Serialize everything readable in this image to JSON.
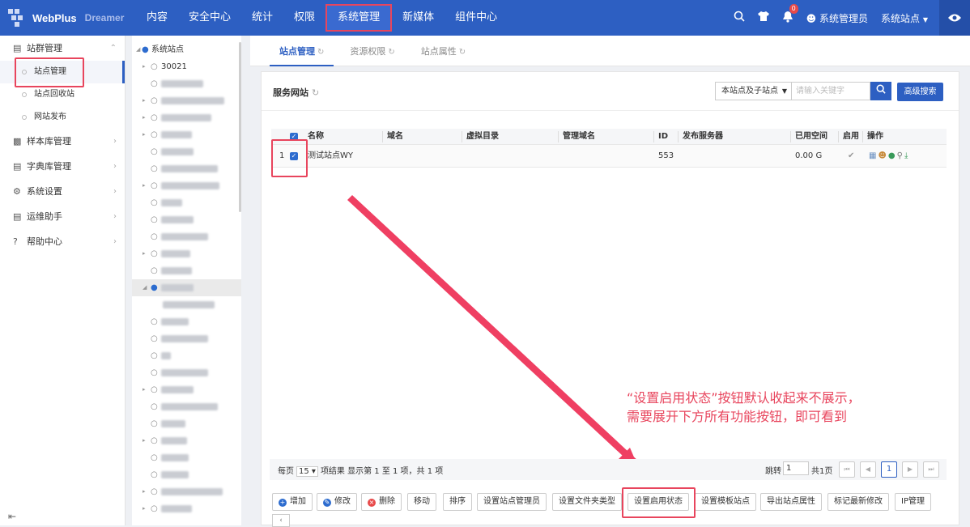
{
  "app": {
    "brand": "WebPlus",
    "brand_sub": "Dreamer"
  },
  "nav": {
    "items": [
      "内容",
      "安全中心",
      "统计",
      "权限",
      "系统管理",
      "新媒体",
      "组件中心"
    ],
    "active_index": 4
  },
  "topbar": {
    "search_icon": "search-icon",
    "shirt_icon": "shirt-icon",
    "bell_icon": "bell-icon",
    "notification_count": "0",
    "user": "系统管理员",
    "site": "系统站点",
    "eye_icon": "eye-icon"
  },
  "sidebar": {
    "groups": [
      {
        "label": "站群管理",
        "subs": [
          "站点管理",
          "站点回收站",
          "网站发布"
        ]
      },
      {
        "label": "样本库管理"
      },
      {
        "label": "字典库管理"
      },
      {
        "label": "系统设置"
      },
      {
        "label": "运维助手"
      },
      {
        "label": "帮助中心"
      }
    ],
    "active_sub": "站点管理"
  },
  "tree": {
    "root": "系统站点",
    "first_child": "30021"
  },
  "tabs": [
    "站点管理",
    "资源权限",
    "站点属性"
  ],
  "panel": {
    "title": "服务网站",
    "scope": "本站点及子站点",
    "keyword_placeholder": "请输入关键字",
    "advanced_search": "高级搜索"
  },
  "grid": {
    "columns": [
      "名称",
      "域名",
      "虚拟目录",
      "管理域名",
      "ID",
      "发布服务器",
      "已用空间",
      "启用",
      "操作"
    ],
    "rows": [
      {
        "index": "1",
        "name": "测试站点WY",
        "domain": "",
        "vdir": "",
        "mgmt": "",
        "id": "553",
        "server": "",
        "space": "0.00 G",
        "enabled": "✔"
      }
    ]
  },
  "annotation": {
    "line1": "“设置启用状态”按钮默认收起来不展示，",
    "line2": "需要展开下方所有功能按钮，即可看到"
  },
  "pager": {
    "per_page_label": "每页",
    "per_page": "15",
    "summary": "项结果 显示第 1 至 1 项，共 1 项",
    "jump_label": "跳转",
    "jump_value": "1",
    "total_pages": "共1页",
    "current_page": "1"
  },
  "actions": [
    "增加",
    "修改",
    "删除",
    "移动",
    "排序",
    "设置站点管理员",
    "设置文件夹类型",
    "设置启用状态",
    "设置模板站点",
    "导出站点属性",
    "标记最新修改",
    "IP管理"
  ],
  "colors": {
    "primary": "#2d5fc2",
    "highlight": "#e8455d"
  }
}
